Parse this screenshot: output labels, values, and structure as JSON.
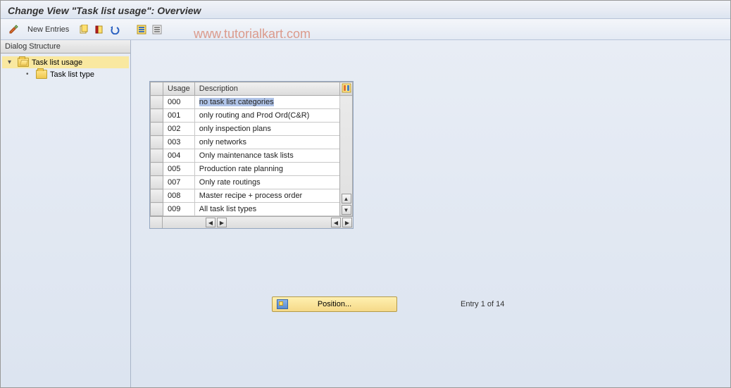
{
  "title": "Change View \"Task list usage\": Overview",
  "toolbar": {
    "new_entries_label": "New Entries"
  },
  "watermark": "www.tutorialkart.com",
  "sidebar": {
    "header": "Dialog Structure",
    "root": {
      "label": "Task list usage"
    },
    "child": {
      "label": "Task list type"
    }
  },
  "table": {
    "columns": {
      "usage": "Usage",
      "description": "Description"
    },
    "rows": [
      {
        "usage": "000",
        "desc": "no task list categories",
        "selected": true
      },
      {
        "usage": "001",
        "desc": "only routing and Prod Ord(C&R)"
      },
      {
        "usage": "002",
        "desc": "only inspection plans"
      },
      {
        "usage": "003",
        "desc": "only networks"
      },
      {
        "usage": "004",
        "desc": "Only maintenance task lists"
      },
      {
        "usage": "005",
        "desc": "Production rate planning"
      },
      {
        "usage": "007",
        "desc": "Only rate routings"
      },
      {
        "usage": "008",
        "desc": "Master recipe + process order"
      },
      {
        "usage": "009",
        "desc": "All task list types"
      }
    ]
  },
  "position_button_label": "Position...",
  "entry_status": "Entry 1 of 14"
}
